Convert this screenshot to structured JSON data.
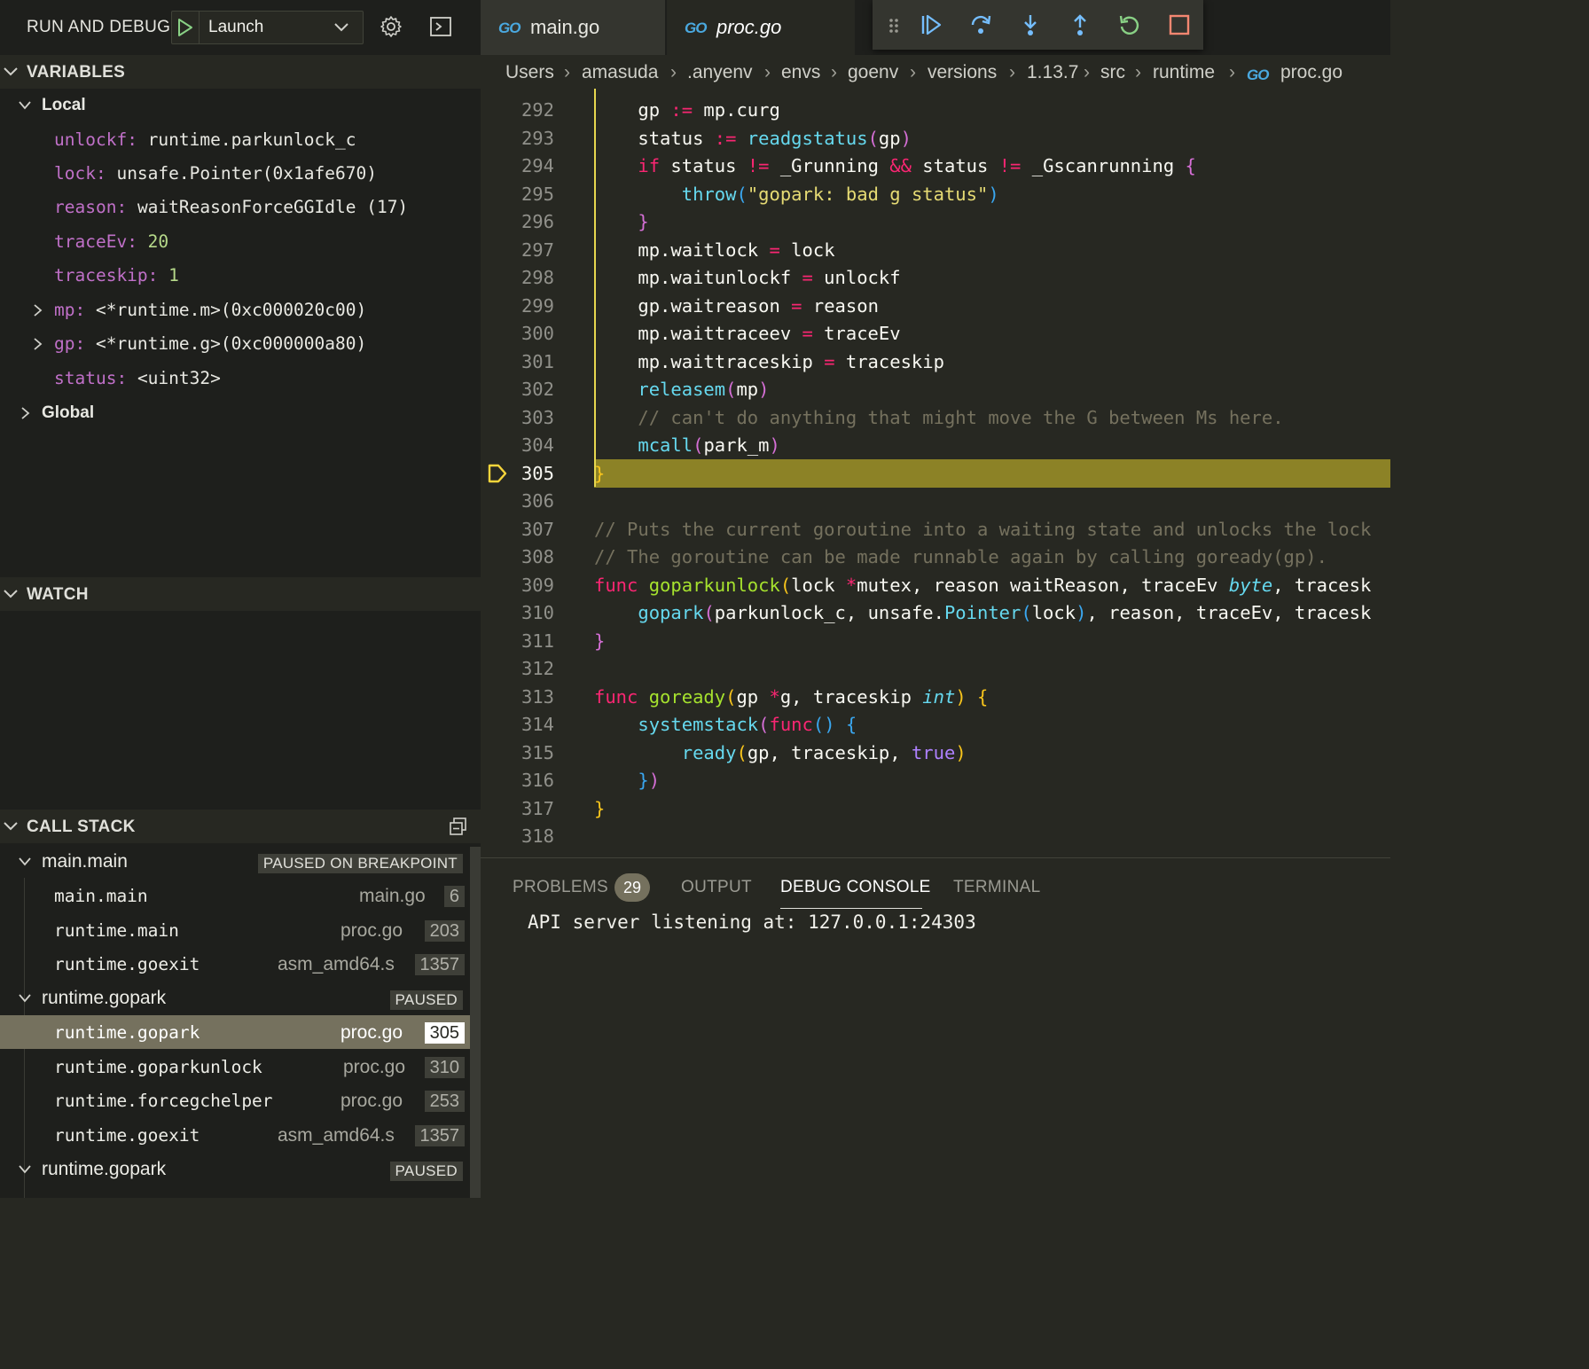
{
  "sidebar": {
    "title": "RUN AND DEBUG",
    "launch_config": "Launch",
    "variables": {
      "header": "VARIABLES",
      "local_label": "Local",
      "global_label": "Global",
      "items": [
        {
          "name": "unlockf",
          "value": "runtime.parkunlock_c"
        },
        {
          "name": "lock",
          "value": "unsafe.Pointer(0x1afe670)"
        },
        {
          "name": "reason",
          "value": "waitReasonForceGGIdle (17)"
        },
        {
          "name": "traceEv",
          "value": "20"
        },
        {
          "name": "traceskip",
          "value": "1"
        },
        {
          "name": "mp",
          "value": "<*runtime.m>(0xc000020c00)"
        },
        {
          "name": "gp",
          "value": "<*runtime.g>(0xc000000a80)"
        },
        {
          "name": "status",
          "value": "<uint32>"
        }
      ]
    },
    "watch_header": "WATCH",
    "call_stack": {
      "header": "CALL STACK",
      "groups": [
        {
          "name": "main.main",
          "badge": "PAUSED ON BREAKPOINT",
          "frames": [
            {
              "fn": "main.main",
              "file": "main.go",
              "line": "6"
            },
            {
              "fn": "runtime.main",
              "file": "proc.go",
              "line": "203"
            },
            {
              "fn": "runtime.goexit",
              "file": "asm_amd64.s",
              "line": "1357"
            }
          ]
        },
        {
          "name": "runtime.gopark",
          "badge": "PAUSED",
          "frames": [
            {
              "fn": "runtime.gopark",
              "file": "proc.go",
              "line": "305"
            },
            {
              "fn": "runtime.goparkunlock",
              "file": "proc.go",
              "line": "310"
            },
            {
              "fn": "runtime.forcegchelper",
              "file": "proc.go",
              "line": "253"
            },
            {
              "fn": "runtime.goexit",
              "file": "asm_amd64.s",
              "line": "1357"
            }
          ]
        },
        {
          "name": "runtime.gopark",
          "badge": "PAUSED",
          "frames": []
        }
      ]
    }
  },
  "editor": {
    "go_icon_text": "GO",
    "tabs": [
      {
        "label": "main.go"
      },
      {
        "label": "proc.go"
      }
    ],
    "breadcrumb": [
      "Users",
      "amasuda",
      ".anyenv",
      "envs",
      "goenv",
      "versions",
      "1.13.7",
      "src",
      "runtime",
      "proc.go"
    ],
    "current_line": "305",
    "lines": [
      {
        "n": "292",
        "code": "    gp := mp.curg"
      },
      {
        "n": "293",
        "code": "    status := readgstatus(gp)"
      },
      {
        "n": "294",
        "code": "    if status != _Grunning && status != _Gscanrunning {"
      },
      {
        "n": "295",
        "code": "        throw(\"gopark: bad g status\")"
      },
      {
        "n": "296",
        "code": "    }"
      },
      {
        "n": "297",
        "code": "    mp.waitlock = lock"
      },
      {
        "n": "298",
        "code": "    mp.waitunlockf = unlockf"
      },
      {
        "n": "299",
        "code": "    gp.waitreason = reason"
      },
      {
        "n": "300",
        "code": "    mp.waittraceev = traceEv"
      },
      {
        "n": "301",
        "code": "    mp.waittraceskip = traceskip"
      },
      {
        "n": "302",
        "code": "    releasem(mp)"
      },
      {
        "n": "303",
        "code": "    // can't do anything that might move the G between Ms here."
      },
      {
        "n": "304",
        "code": "    mcall(park_m)"
      },
      {
        "n": "305",
        "code": "}"
      },
      {
        "n": "306",
        "code": ""
      },
      {
        "n": "307",
        "code": "// Puts the current goroutine into a waiting state and unlocks the lock"
      },
      {
        "n": "308",
        "code": "// The goroutine can be made runnable again by calling goready(gp)."
      },
      {
        "n": "309",
        "code": "func goparkunlock(lock *mutex, reason waitReason, traceEv byte, tracesk"
      },
      {
        "n": "310",
        "code": "    gopark(parkunlock_c, unsafe.Pointer(lock), reason, traceEv, tracesk"
      },
      {
        "n": "311",
        "code": "}"
      },
      {
        "n": "312",
        "code": ""
      },
      {
        "n": "313",
        "code": "func goready(gp *g, traceskip int) {"
      },
      {
        "n": "314",
        "code": "    systemstack(func() {"
      },
      {
        "n": "315",
        "code": "        ready(gp, traceskip, true)"
      },
      {
        "n": "316",
        "code": "    })"
      },
      {
        "n": "317",
        "code": "}"
      },
      {
        "n": "318",
        "code": ""
      }
    ]
  },
  "panel": {
    "tabs": [
      "PROBLEMS",
      "OUTPUT",
      "DEBUG CONSOLE",
      "TERMINAL"
    ],
    "problems_count": "29",
    "active_tab": "DEBUG CONSOLE",
    "console_output": "API server listening at: 127.0.0.1:24303"
  }
}
